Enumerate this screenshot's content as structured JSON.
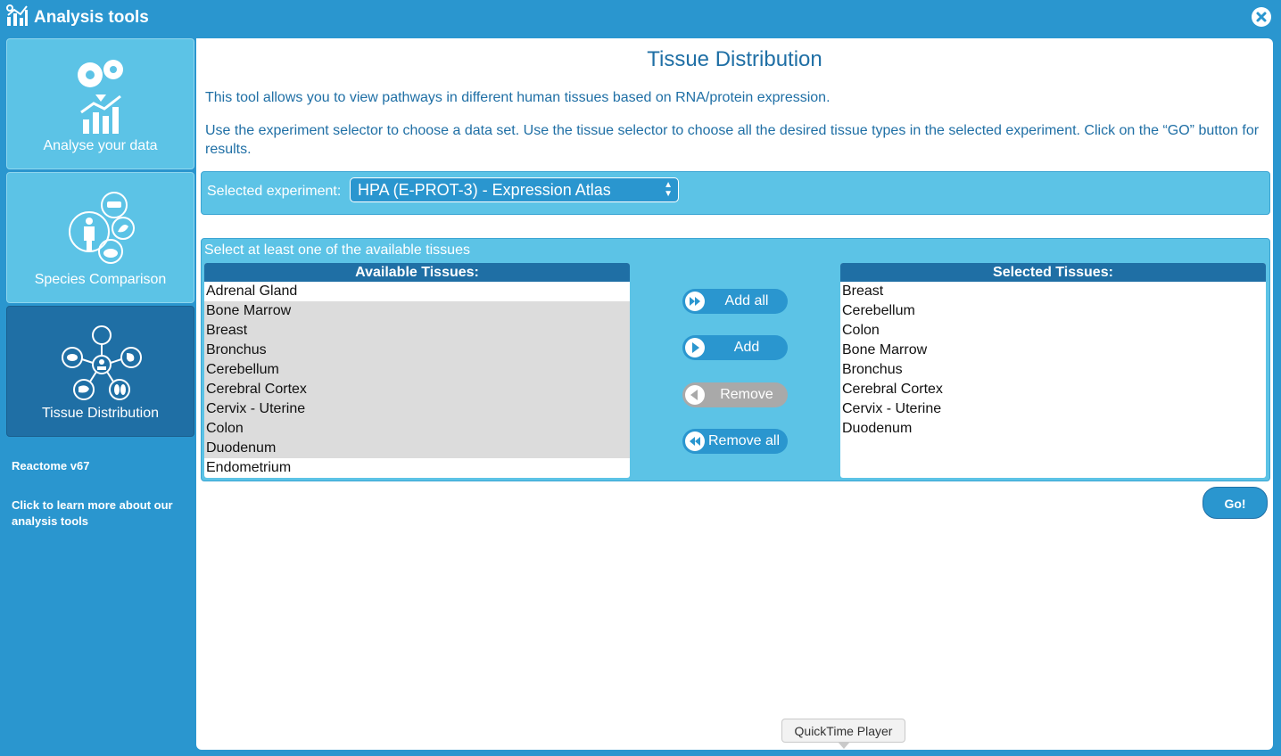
{
  "window": {
    "title": "Analysis tools",
    "app_icon": "analysis-chart-icon",
    "close_icon": "close-icon"
  },
  "sidebar": {
    "tabs": [
      {
        "label": "Analyse your data",
        "icon": "gears-chart-icon",
        "active": false
      },
      {
        "label": "Species Comparison",
        "icon": "species-icon",
        "active": false
      },
      {
        "label": "Tissue Distribution",
        "icon": "tissue-network-icon",
        "active": true
      }
    ],
    "version": "Reactome v67",
    "learn_more": "Click to learn more about our analysis tools"
  },
  "main": {
    "title": "Tissue Distribution",
    "description_1": "This tool allows you to view pathways in different human tissues based on RNA/protein expression.",
    "description_2": "Use the experiment selector to choose a data set. Use the tissue selector to choose all the desired tissue types in the selected experiment. Click on the “GO” button for results.",
    "experiment": {
      "label": "Selected experiment:",
      "value": "HPA (E-PROT-3) - Expression Atlas"
    },
    "tissue_hint": "Select at least one of the available tissues",
    "available": {
      "header": "Available Tissues:",
      "items": [
        "Adrenal Gland",
        "Bone Marrow",
        "Breast",
        "Bronchus",
        "Cerebellum",
        "Cerebral Cortex",
        "Cervix - Uterine",
        "Colon",
        "Duodenum",
        "Endometrium"
      ]
    },
    "selected": {
      "header": "Selected Tissues:",
      "items": [
        "Breast",
        "Cerebellum",
        "Colon",
        "Bone Marrow",
        "Bronchus",
        "Cerebral Cortex",
        "Cervix - Uterine",
        "Duodenum"
      ]
    },
    "buttons": {
      "add_all": "Add all",
      "add": "Add",
      "remove": "Remove",
      "remove_all": "Remove all",
      "go": "Go!"
    }
  },
  "tooltip": "QuickTime Player",
  "colors": {
    "frame": "#2a96cf",
    "panel": "#5cc3e6",
    "accent": "#1f6fa5",
    "highlight": "#dcdcdc",
    "disabled": "#a9a9a9"
  }
}
